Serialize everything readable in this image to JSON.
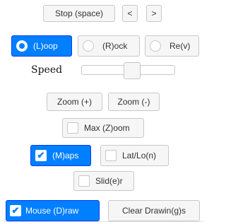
{
  "controls": {
    "stop_label": "Stop (space)",
    "prev_label": "<",
    "next_label": ">",
    "loop_label": "(L)oop",
    "rock_label": "(R)ock",
    "rev_label": "Re(v)",
    "speed_label": "Speed",
    "speed_fraction": 0.55,
    "zoom_in_label": "Zoom (+)",
    "zoom_out_label": "Zoom (-)",
    "max_zoom_label": "Max (Z)oom",
    "maps_label": "(M)aps",
    "latlon_label": "Lat/Lo(n)",
    "slider_label": "Slid(e)r",
    "mouse_draw_label": "Mouse (D)raw",
    "clear_label": "Clear Drawin(g)s"
  },
  "state": {
    "loop_selected": true,
    "maps_checked": true,
    "latlon_checked": false,
    "slider_checked": false,
    "max_zoom_checked": false,
    "mouse_draw_checked": true
  },
  "colors": {
    "active": "#007fff",
    "active_border": "#003eff",
    "default_bg": "#f6f6f6"
  }
}
